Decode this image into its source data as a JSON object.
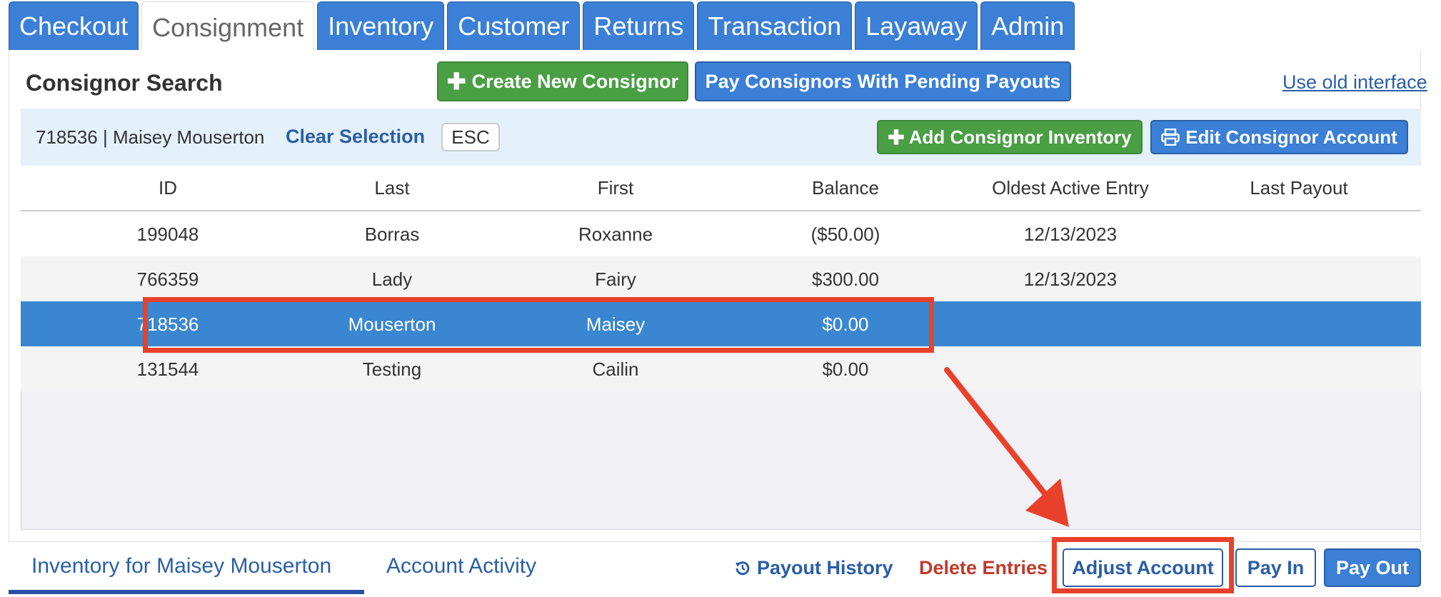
{
  "tabs": [
    {
      "label": "Checkout"
    },
    {
      "label": "Consignment"
    },
    {
      "label": "Inventory"
    },
    {
      "label": "Customer"
    },
    {
      "label": "Returns"
    },
    {
      "label": "Transaction"
    },
    {
      "label": "Layaway"
    },
    {
      "label": "Admin"
    }
  ],
  "header": {
    "title": "Consignor Search",
    "create_button": "Create New Consignor",
    "pay_pending_button": "Pay Consignors With Pending Payouts",
    "old_interface_link": "Use old interface"
  },
  "selection": {
    "text": "718536 | Maisey Mouserton",
    "clear_link": "Clear Selection",
    "esc_label": "ESC",
    "add_inventory_button": "Add Consignor Inventory",
    "edit_account_button": "Edit Consignor Account"
  },
  "table": {
    "columns": [
      "ID",
      "Last",
      "First",
      "Balance",
      "Oldest Active Entry",
      "Last Payout"
    ],
    "rows": [
      {
        "id": "199048",
        "last": "Borras",
        "first": "Roxanne",
        "balance": "($50.00)",
        "oldest": "12/13/2023",
        "last_payout": ""
      },
      {
        "id": "766359",
        "last": "Lady",
        "first": "Fairy",
        "balance": "$300.00",
        "oldest": "12/13/2023",
        "last_payout": ""
      },
      {
        "id": "718536",
        "last": "Mouserton",
        "first": "Maisey",
        "balance": "$0.00",
        "oldest": "",
        "last_payout": ""
      },
      {
        "id": "131544",
        "last": "Testing",
        "first": "Cailin",
        "balance": "$0.00",
        "oldest": "",
        "last_payout": ""
      }
    ]
  },
  "bottom": {
    "tab_inventory": "Inventory for Maisey Mouserton",
    "tab_activity": "Account Activity",
    "payout_history": "Payout History",
    "delete_entries": "Delete Entries",
    "adjust_account": "Adjust Account",
    "pay_in": "Pay In",
    "pay_out": "Pay Out"
  },
  "colors": {
    "primary": "#3b7fd6",
    "green": "#4a9e44",
    "selected_row": "#3a86d0",
    "annotation": "#e8412c",
    "danger_text": "#c0392b"
  },
  "icons": {
    "create": "plus-icon",
    "add_inventory": "plus-icon",
    "edit_account": "printer-icon",
    "payout_history": "history-icon",
    "annotation_arrow": "arrow-icon"
  }
}
